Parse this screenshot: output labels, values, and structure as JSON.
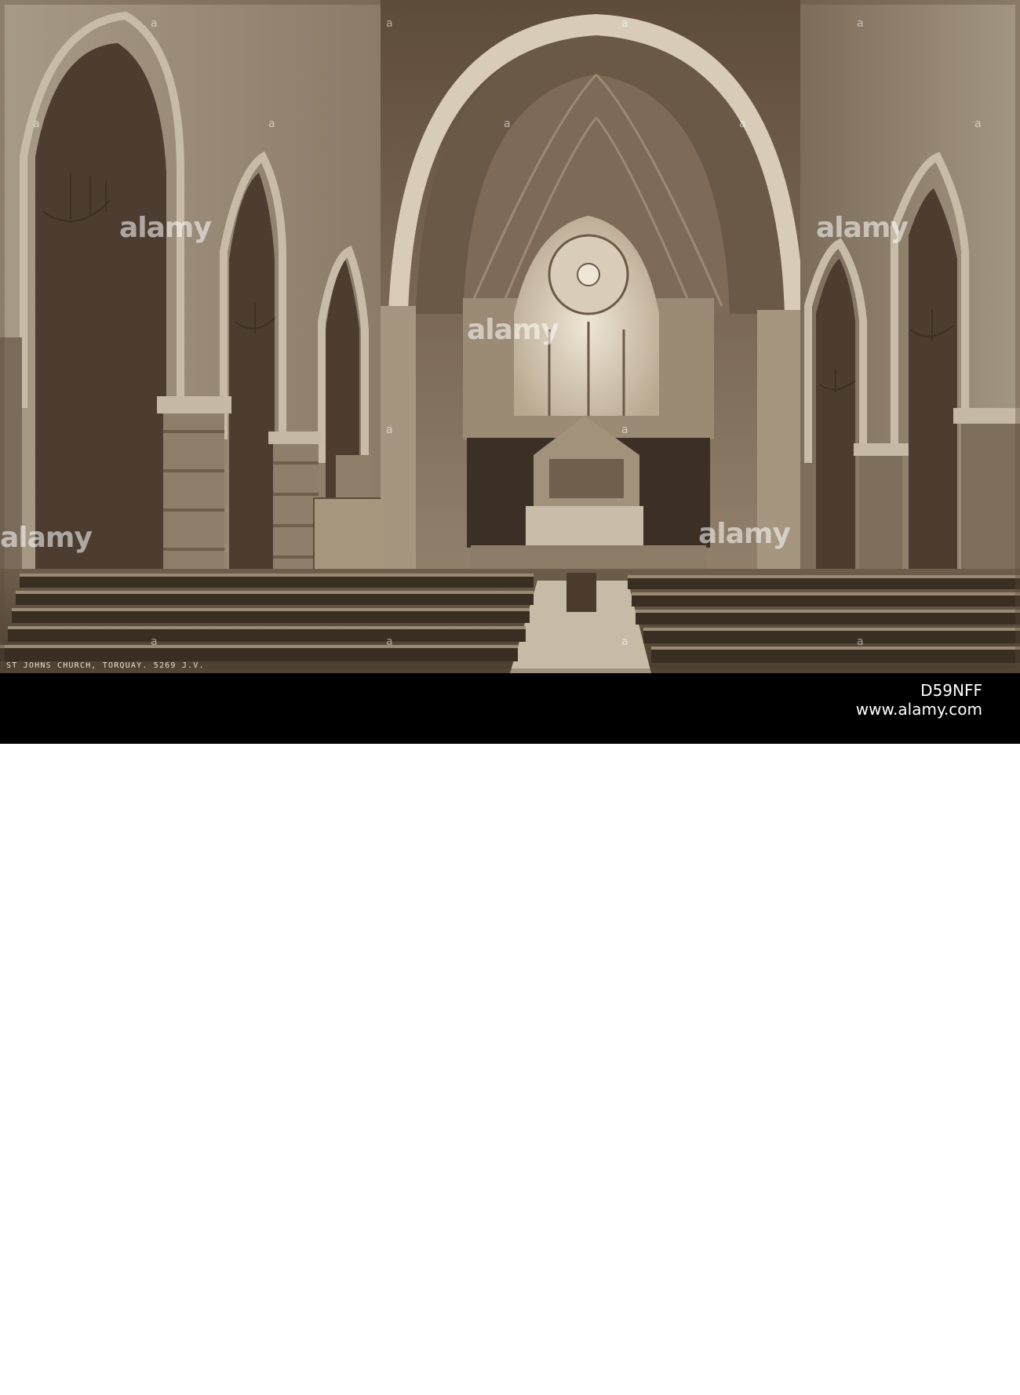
{
  "photo": {
    "caption": "ST JOHNS CHURCH, TORQUAY. 5269 J.V."
  },
  "watermark": {
    "brand": "alamy",
    "small_text": "a"
  },
  "footer": {
    "logo": "alamy",
    "image_id": "D59NFF",
    "site": "www.alamy.com"
  }
}
